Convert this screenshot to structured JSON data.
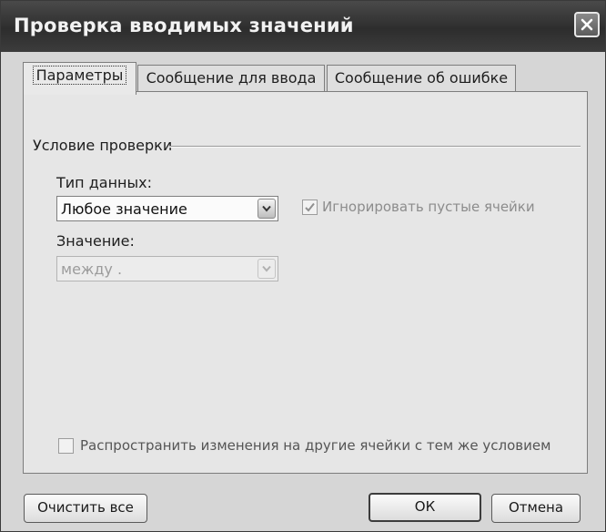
{
  "dialog": {
    "title": "Проверка вводимых значений"
  },
  "tabs": [
    {
      "label": "Параметры",
      "active": true
    },
    {
      "label": "Сообщение для ввода",
      "active": false
    },
    {
      "label": "Сообщение об ошибке",
      "active": false
    }
  ],
  "settings": {
    "group_label": "Условие проверки",
    "data_type_label": "Тип данных:",
    "data_type_value": "Любое значение",
    "ignore_blank_label": "Игнорировать пустые ячейки",
    "ignore_blank_checked": true,
    "value_label": "Значение:",
    "value_value": "между .",
    "apply_all_label": "Распространить изменения на другие ячейки с тем же условием",
    "apply_all_checked": false
  },
  "buttons": {
    "clear_all": "Очистить все",
    "ok": "ОК",
    "cancel": "Отмена"
  },
  "icons": {
    "close": "close-icon",
    "dropdown": "chevron-down-icon",
    "check": "checkmark-icon"
  }
}
